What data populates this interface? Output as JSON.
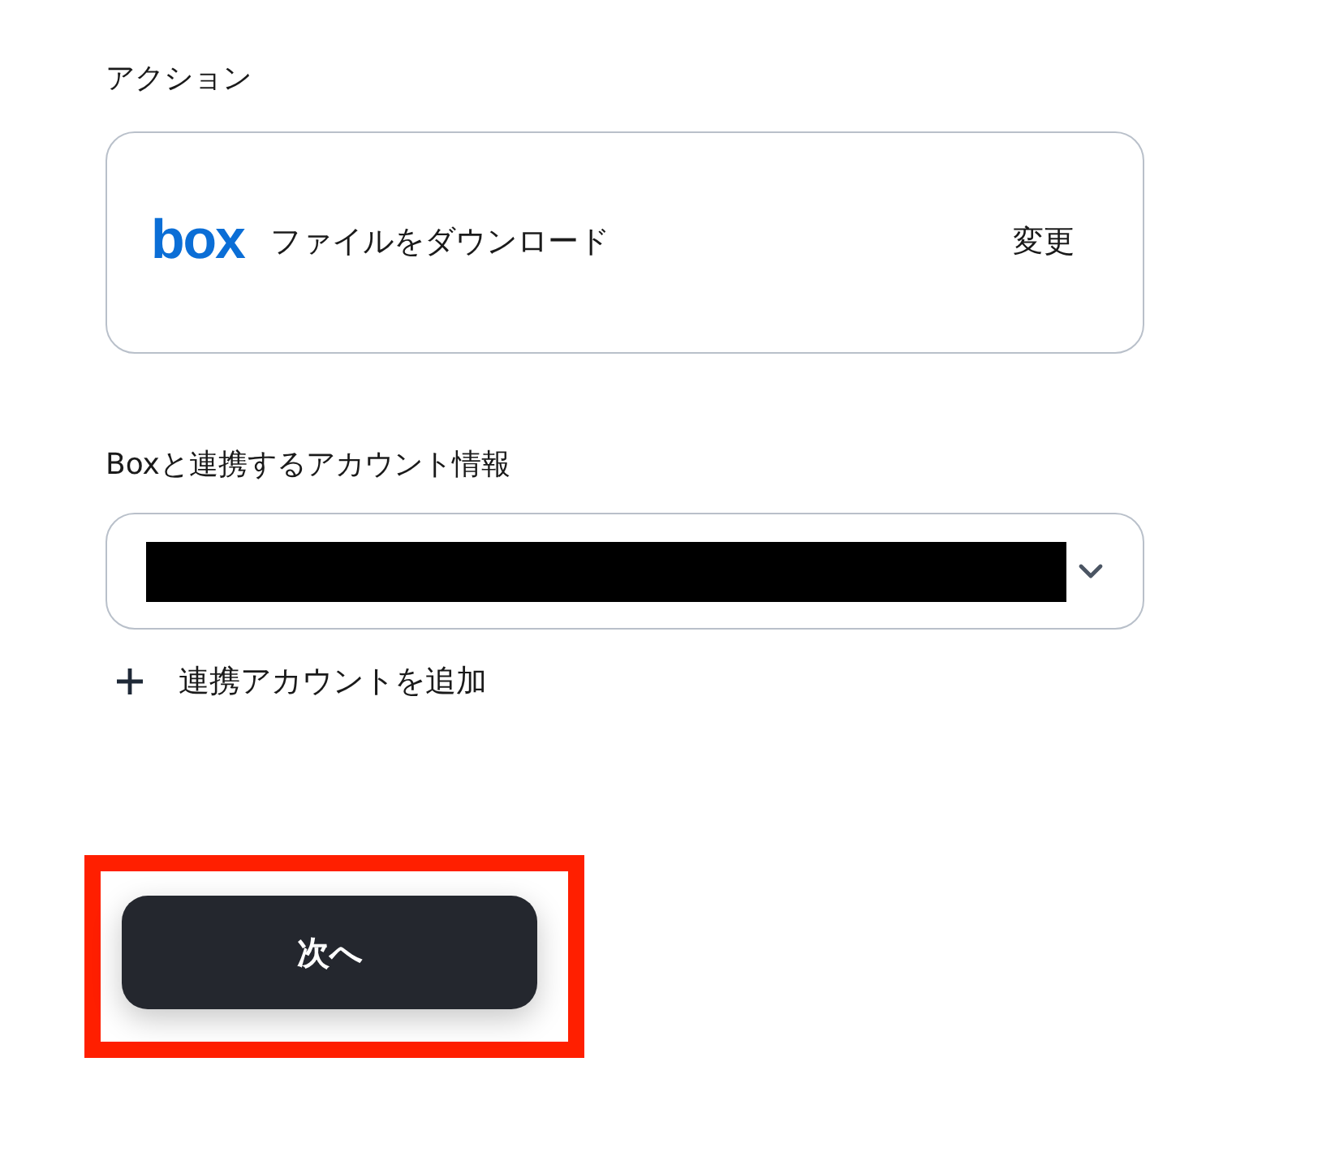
{
  "action_section": {
    "heading": "アクション",
    "card": {
      "logo_text": "box",
      "title": "ファイルをダウンロード",
      "change_link": "変更"
    }
  },
  "account_section": {
    "label": "Boxと連携するアカウント情報",
    "select": {
      "redacted": true
    },
    "add_account": "連携アカウントを追加"
  },
  "next_button": {
    "label": "次へ",
    "highlighted": true
  }
}
